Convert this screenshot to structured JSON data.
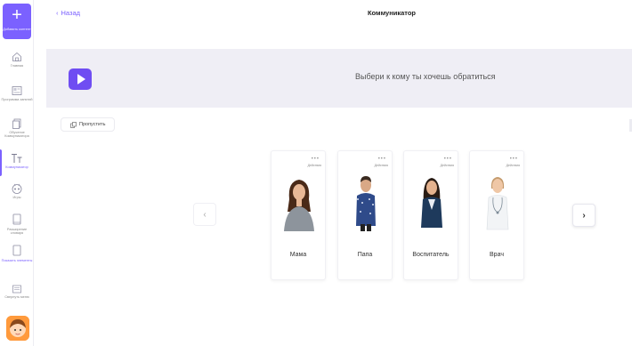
{
  "sidebar": {
    "add_label": "Добавить контент",
    "items": [
      {
        "label": "Главная",
        "icon": "home-icon"
      },
      {
        "label": "Программа занятий",
        "icon": "program-icon"
      },
      {
        "label": "Обучение Коммуникатора",
        "icon": "training-icon"
      },
      {
        "label": "Коммуникатор",
        "icon": "text-icon",
        "active": true
      },
      {
        "label": "Игры",
        "icon": "games-icon"
      },
      {
        "label": "Расширение словаря",
        "icon": "vocabulary-icon"
      },
      {
        "label": "Показать элементы",
        "icon": "elements-icon"
      },
      {
        "label": "Свернуть меню",
        "icon": "collapse-icon"
      }
    ]
  },
  "header": {
    "back_label": "Назад",
    "title": "Коммуникатор"
  },
  "banner": {
    "prompt": "Выбери к кому ты хочешь обратиться"
  },
  "skip_label": "Пропустить",
  "cards": [
    {
      "name": "Мама",
      "actions_label": "Действия"
    },
    {
      "name": "Папа",
      "actions_label": "Действия"
    },
    {
      "name": "Воспитатель",
      "actions_label": "Действия"
    },
    {
      "name": "Врач",
      "actions_label": "Действия"
    }
  ],
  "colors": {
    "accent": "#7b61ff",
    "banner_bg": "#efeef5",
    "play_button": "#6f4df2"
  }
}
